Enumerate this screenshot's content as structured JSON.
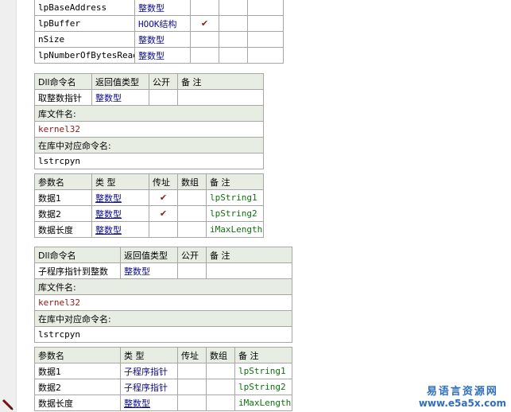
{
  "top_table": {
    "rows": [
      {
        "name": "lpBaseAddress",
        "type": "整数型",
        "byref": "",
        "arr": "",
        "note": ""
      },
      {
        "name": "lpBuffer",
        "type": "HOOK结构",
        "byref": "✔",
        "arr": "",
        "note": ""
      },
      {
        "name": "nSize",
        "type": "整数型",
        "byref": "",
        "arr": "",
        "note": ""
      },
      {
        "name": "lpNumberOfBytesRead",
        "type": "整数型",
        "byref": "",
        "arr": "",
        "note": ""
      }
    ]
  },
  "dll1": {
    "header": {
      "c1": "Dll命令名",
      "c2": "返回值类型",
      "c3": "公开",
      "c4": "备 注"
    },
    "cmd": {
      "name": "取整数指针",
      "ret": "整数型",
      "public": "",
      "note": ""
    },
    "lib_label": "库文件名:",
    "lib_value": "kernel32",
    "entry_label": "在库中对应命令名:",
    "entry_value": "lstrcpyn",
    "param_header": {
      "c1": "参数名",
      "c2": "类 型",
      "c3": "传址",
      "c4": "数组",
      "c5": "备 注"
    },
    "params": [
      {
        "name": "数据1",
        "type": "整数型",
        "byref": "✔",
        "arr": "",
        "note": "lpString1"
      },
      {
        "name": "数据2",
        "type": "整数型",
        "byref": "✔",
        "arr": "",
        "note": "lpString2"
      },
      {
        "name": "数据长度",
        "type": "整数型",
        "byref": "",
        "arr": "",
        "note": "iMaxLength"
      }
    ]
  },
  "dll2": {
    "header": {
      "c1": "Dll命令名",
      "c2": "返回值类型",
      "c3": "公开",
      "c4": "备 注"
    },
    "cmd": {
      "name": "子程序指针到整数",
      "ret": "整数型",
      "public": "",
      "note": ""
    },
    "lib_label": "库文件名:",
    "lib_value": "kernel32",
    "entry_label": "在库中对应命令名:",
    "entry_value": "lstrcpyn",
    "param_header": {
      "c1": "参数名",
      "c2": "类 型",
      "c3": "传址",
      "c4": "数组",
      "c5": "备 注"
    },
    "params": [
      {
        "name": "数据1",
        "type": "子程序指针",
        "byref": "",
        "arr": "",
        "note": "lpString1"
      },
      {
        "name": "数据2",
        "type": "子程序指针",
        "byref": "",
        "arr": "",
        "note": "lpString2"
      },
      {
        "name": "数据长度",
        "type": "整数型",
        "byref": "",
        "arr": "",
        "note": "iMaxLength"
      }
    ]
  },
  "watermark": {
    "line1": "易语言资源网",
    "line2": "www.e5a5x.com"
  },
  "icons": {
    "gutter_marker": "pencil-icon"
  },
  "colors": {
    "header_bg": "#e8ede4",
    "type_blue": "#0b0b8f",
    "note_green": "#107010",
    "check_red": "#8b1a1a",
    "watermark": "#2f6fc0"
  }
}
